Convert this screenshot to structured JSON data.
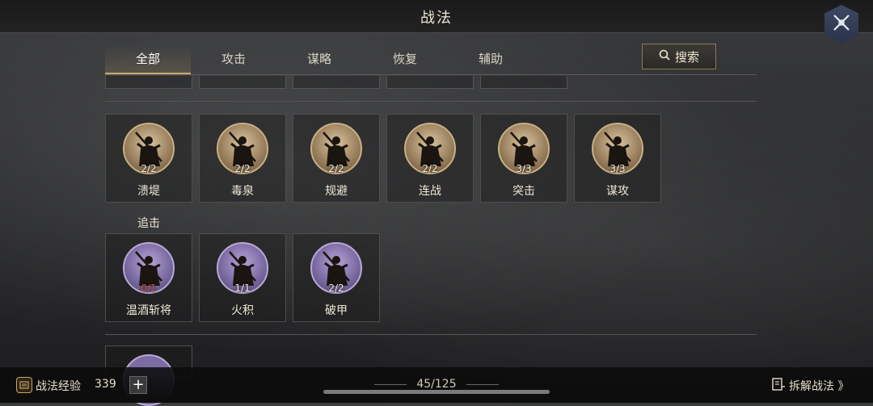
{
  "header": {
    "title": "战法"
  },
  "tabs": [
    {
      "label": "全部",
      "active": true
    },
    {
      "label": "攻击"
    },
    {
      "label": "谋略"
    },
    {
      "label": "恢复"
    },
    {
      "label": "辅助"
    }
  ],
  "search": {
    "label": "搜索"
  },
  "section_top": {
    "cards": [
      {
        "name": "溃堤",
        "count": "2/2"
      },
      {
        "name": "毒泉",
        "count": "2/2"
      },
      {
        "name": "规避",
        "count": "2/2"
      },
      {
        "name": "连战",
        "count": "2/2"
      },
      {
        "name": "突击",
        "count": "3/3"
      },
      {
        "name": "谋攻",
        "count": "3/3"
      }
    ]
  },
  "section_zhuiji": {
    "label": "追击",
    "cards": [
      {
        "name": "温酒斩将",
        "count": "0/1",
        "count_color": "#d0562f"
      },
      {
        "name": "火积",
        "count": "1/1"
      },
      {
        "name": "破甲",
        "count": "2/2"
      }
    ]
  },
  "footer": {
    "xp_label": "战法经验",
    "xp_value": "339",
    "plus": "+",
    "counter": "45/125",
    "decompose_label": "拆解战法 》"
  },
  "colors": {
    "accent_gold": "#c9a96b",
    "red_count": "#d0562f",
    "purple_medal": "#7d6ca4",
    "gold_medal": "#9d8260"
  },
  "icons": [
    "crossed-swords-icon",
    "search-icon",
    "xp-scroll-icon",
    "plus-icon",
    "decompose-icon"
  ]
}
